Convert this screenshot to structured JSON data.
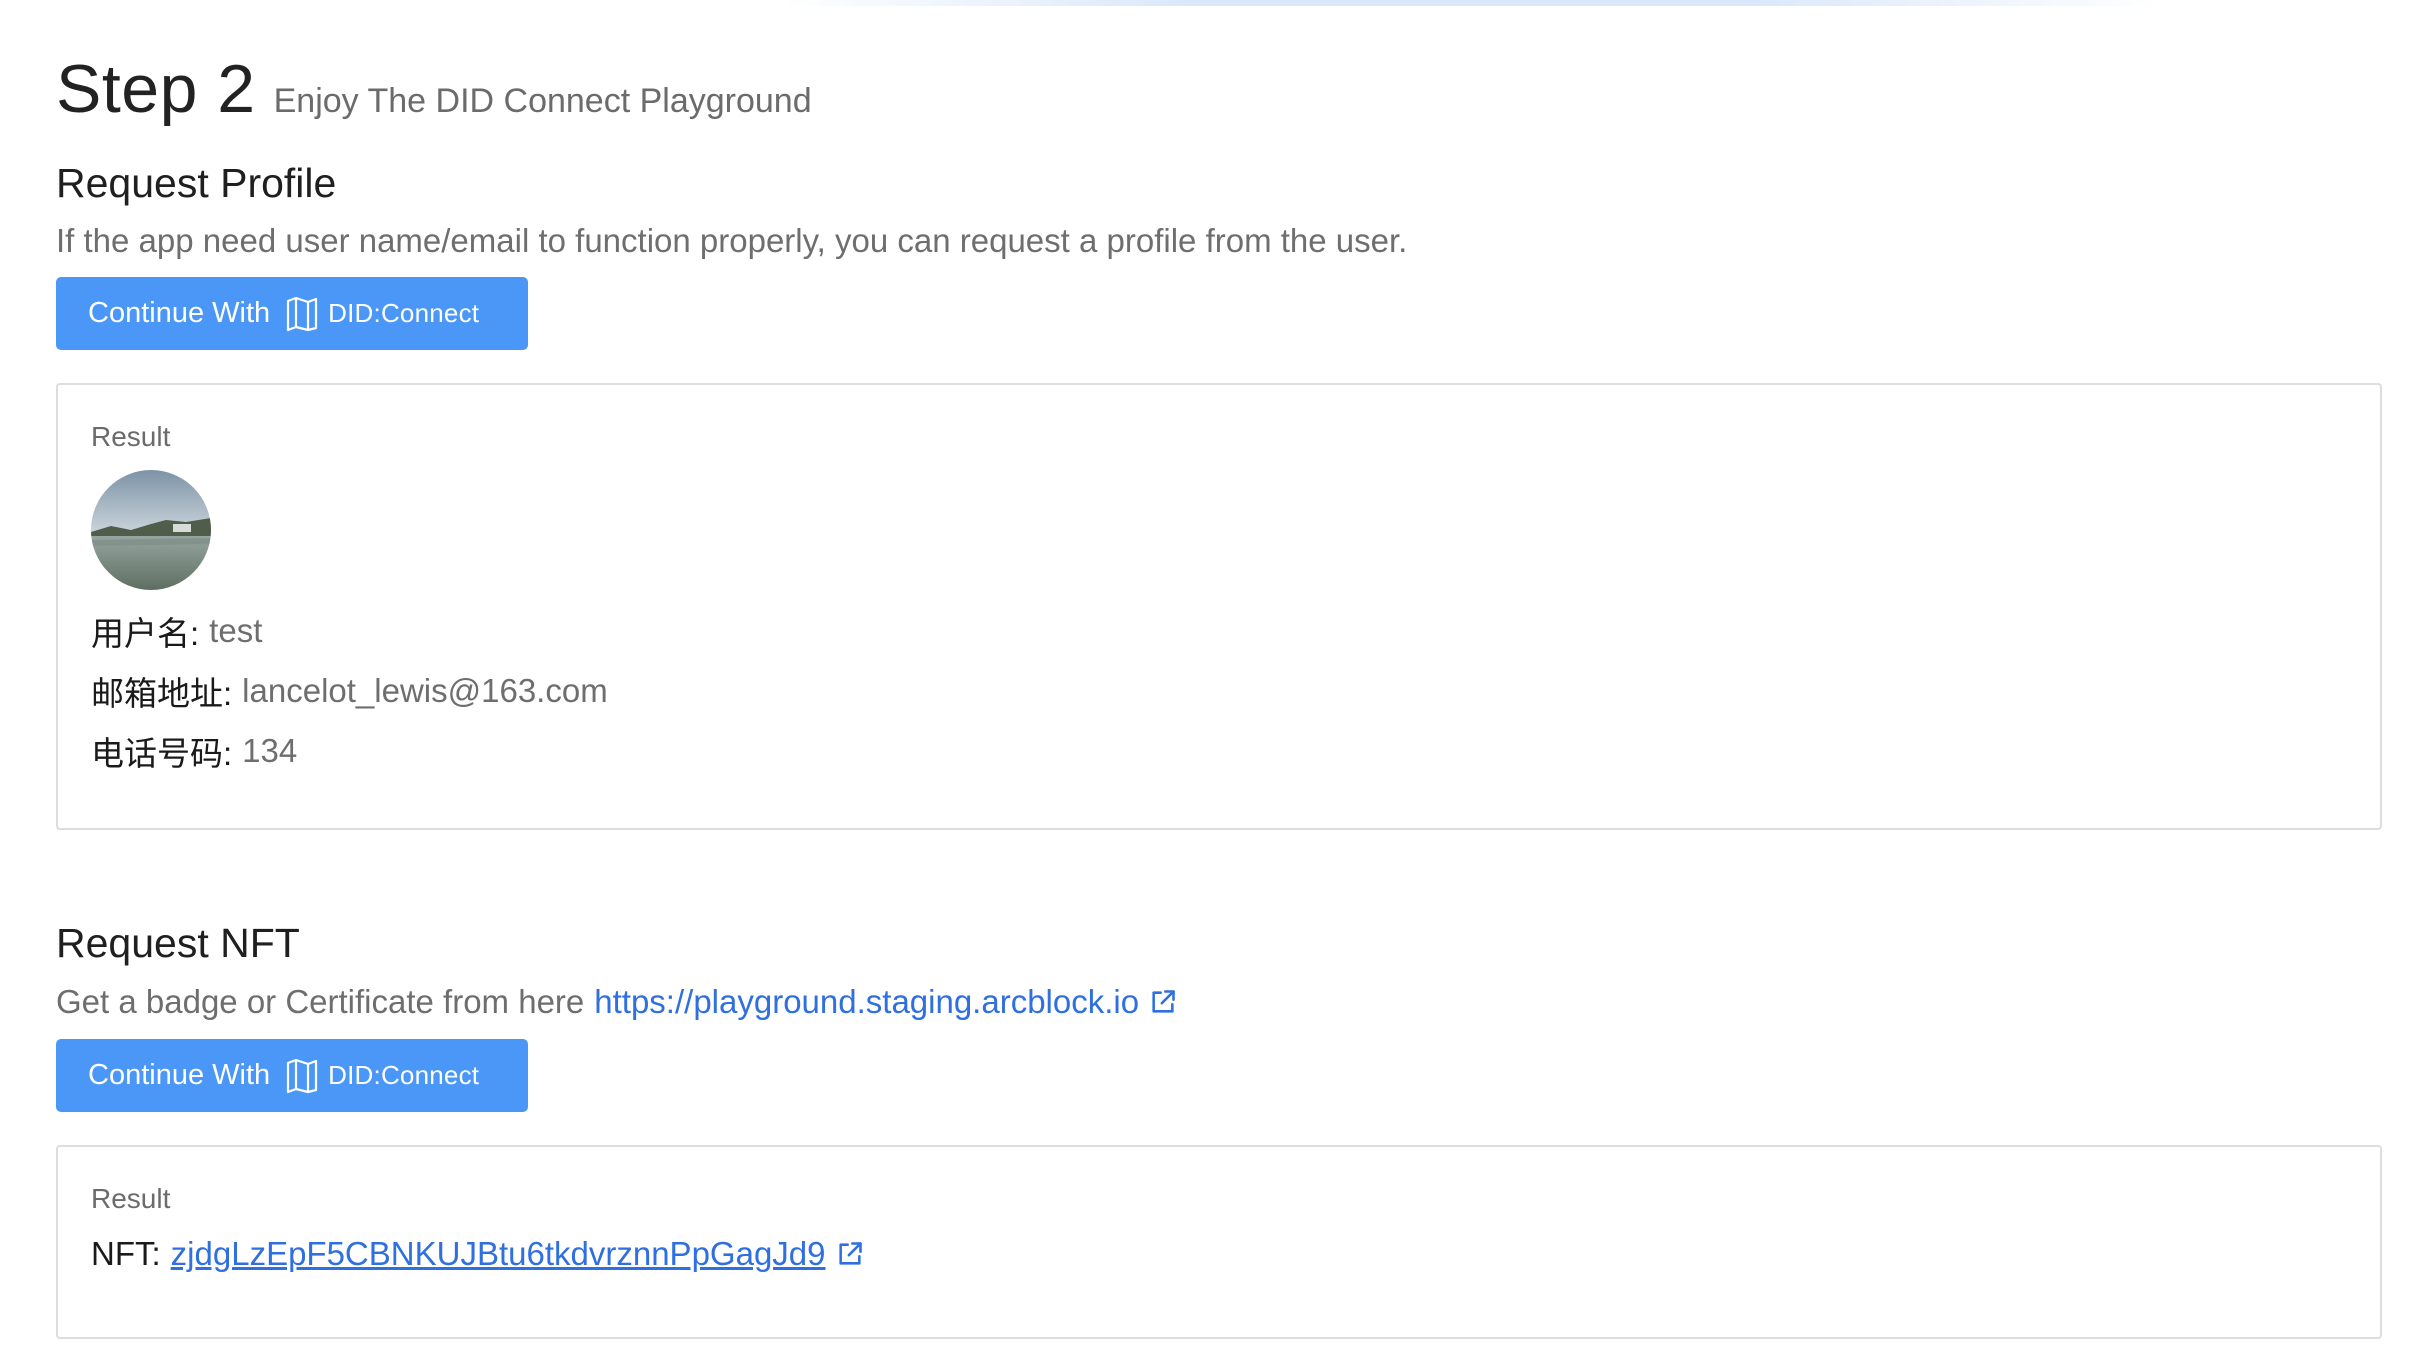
{
  "header": {
    "step_title": "Step 2",
    "step_subtitle": "Enjoy The DID Connect Playground"
  },
  "profile_section": {
    "title": "Request Profile",
    "description": "If the app need user name/email to function properly, you can request a profile from the user.",
    "button": {
      "prefix": "Continue With",
      "brand": "DID:Connect"
    },
    "result": {
      "label": "Result",
      "fields": [
        {
          "key": "用户名:",
          "value": "test"
        },
        {
          "key": "邮箱地址:",
          "value": "lancelot_lewis@163.com"
        },
        {
          "key": "电话号码:",
          "value": "134"
        }
      ]
    }
  },
  "nft_section": {
    "title": "Request NFT",
    "description": "Get a badge or Certificate from here",
    "link_text": "https://playground.staging.arcblock.io",
    "button": {
      "prefix": "Continue With",
      "brand": "DID:Connect"
    },
    "result": {
      "label": "Result",
      "nft_key": "NFT:",
      "nft_value": "zjdgLzEpF5CBNKUJBtu6tkdvrznnPpGagJd9"
    }
  },
  "colors": {
    "button": "#4a97f7",
    "link": "#2f6fe0",
    "muted_text": "#6e6e6e",
    "border": "#dddddd"
  },
  "icons": {
    "button_logo": "did-logo-icon",
    "external_link": "external-link-icon"
  }
}
